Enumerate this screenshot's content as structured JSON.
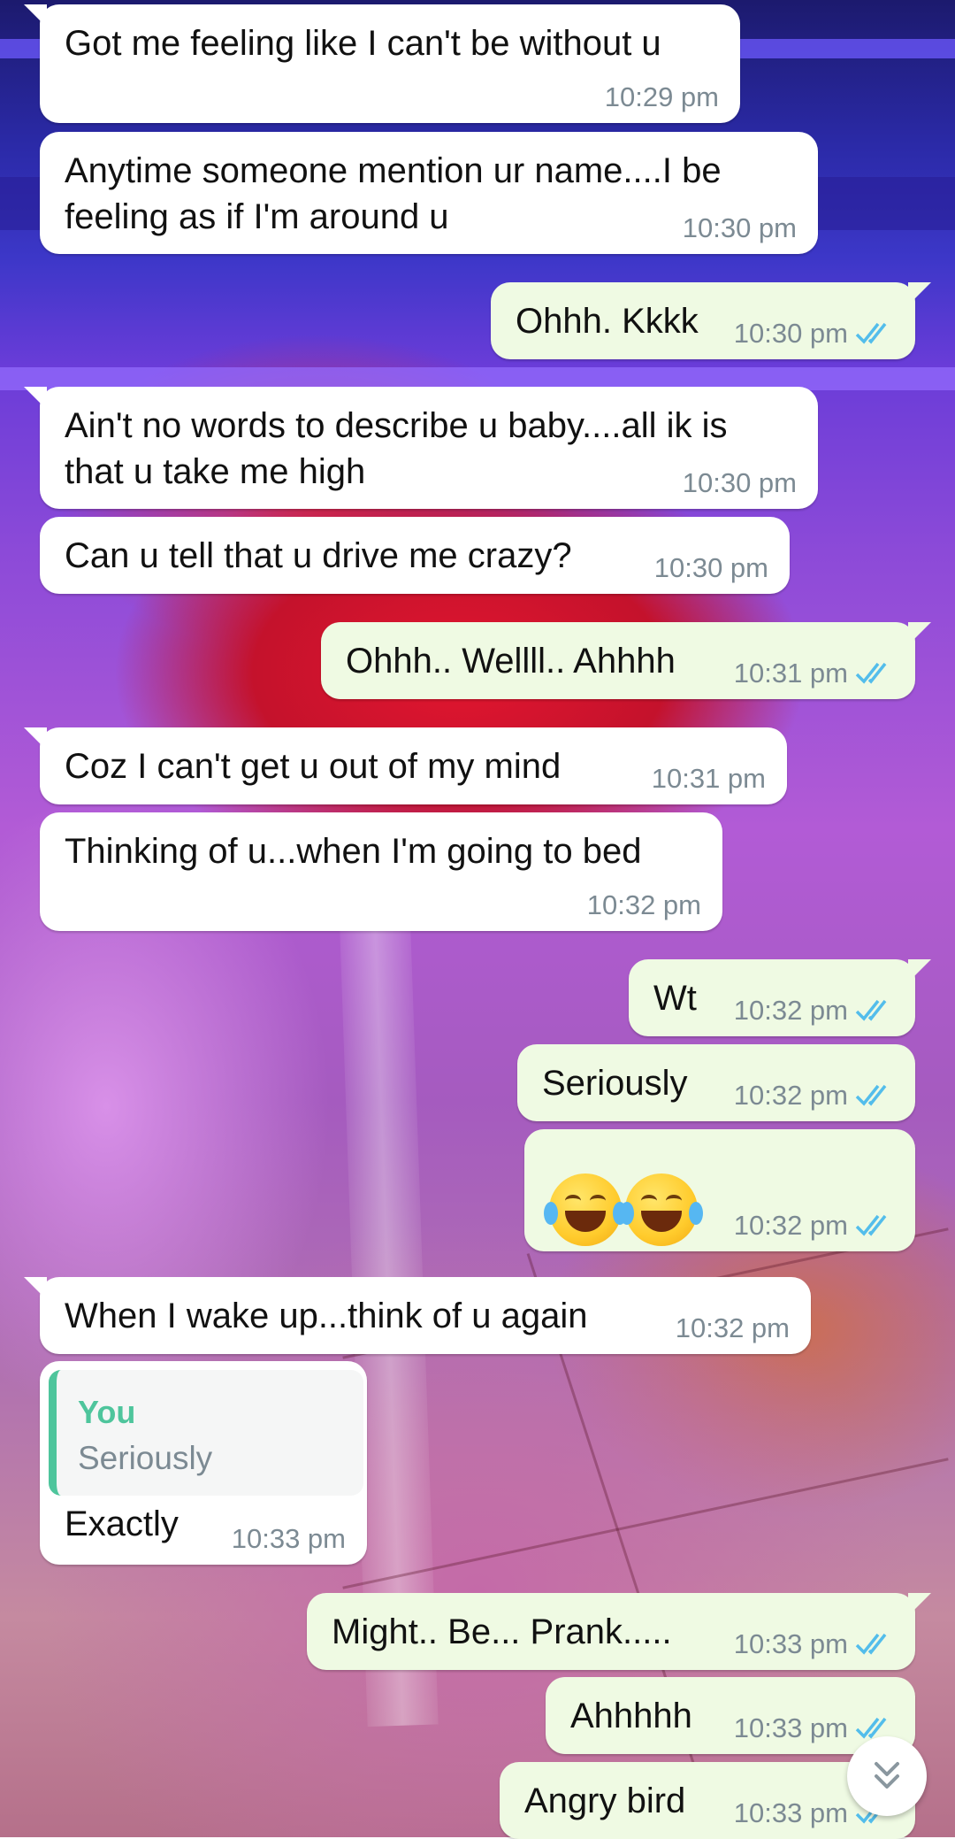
{
  "colors": {
    "incoming_bubble": "#ffffff",
    "outgoing_bubble": "#effae3",
    "timestamp": "#7c8a93",
    "read_ticks": "#53bdeb",
    "quote_accent": "#4ec59c"
  },
  "messages": [
    {
      "direction": "in",
      "text": "Got me feeling like I can't be without u",
      "time": "10:29 pm"
    },
    {
      "direction": "in",
      "text": "Anytime someone mention ur name....I be\nfeeling as if I'm around u",
      "time": "10:30 pm"
    },
    {
      "direction": "out",
      "text": "Ohhh. Kkkk",
      "time": "10:30 pm",
      "status": "read"
    },
    {
      "direction": "in",
      "text": "Ain't no words to describe u baby....all ik is\nthat u take me high",
      "time": "10:30 pm"
    },
    {
      "direction": "in",
      "text": "Can u tell that u drive me crazy?",
      "time": "10:30 pm"
    },
    {
      "direction": "out",
      "text": "Ohhh.. Wellll.. Ahhhh",
      "time": "10:31 pm",
      "status": "read"
    },
    {
      "direction": "in",
      "text": "Coz I can't get u out of my mind",
      "time": "10:31 pm"
    },
    {
      "direction": "in",
      "text": "Thinking of u...when I'm going to bed",
      "time": "10:32 pm"
    },
    {
      "direction": "out",
      "text": "Wt",
      "time": "10:32 pm",
      "status": "read"
    },
    {
      "direction": "out",
      "text": "Seriously",
      "time": "10:32 pm",
      "status": "read"
    },
    {
      "direction": "out",
      "emoji": "face-with-tears-of-joy-x2",
      "time": "10:32 pm",
      "status": "read"
    },
    {
      "direction": "in",
      "text": "When I wake up...think of u again",
      "time": "10:32 pm"
    },
    {
      "direction": "in",
      "quote": {
        "sender": "You",
        "text": "Seriously"
      },
      "text": "Exactly",
      "time": "10:33 pm"
    },
    {
      "direction": "out",
      "text": "Might.. Be... Prank.....",
      "time": "10:33 pm",
      "status": "read"
    },
    {
      "direction": "out",
      "text": "Ahhhhh",
      "time": "10:33 pm",
      "status": "read"
    },
    {
      "direction": "out",
      "text": "Angry bird",
      "time": "10:33 pm",
      "status": "read"
    }
  ],
  "scroll_button_icon": "double-chevron-down-icon"
}
